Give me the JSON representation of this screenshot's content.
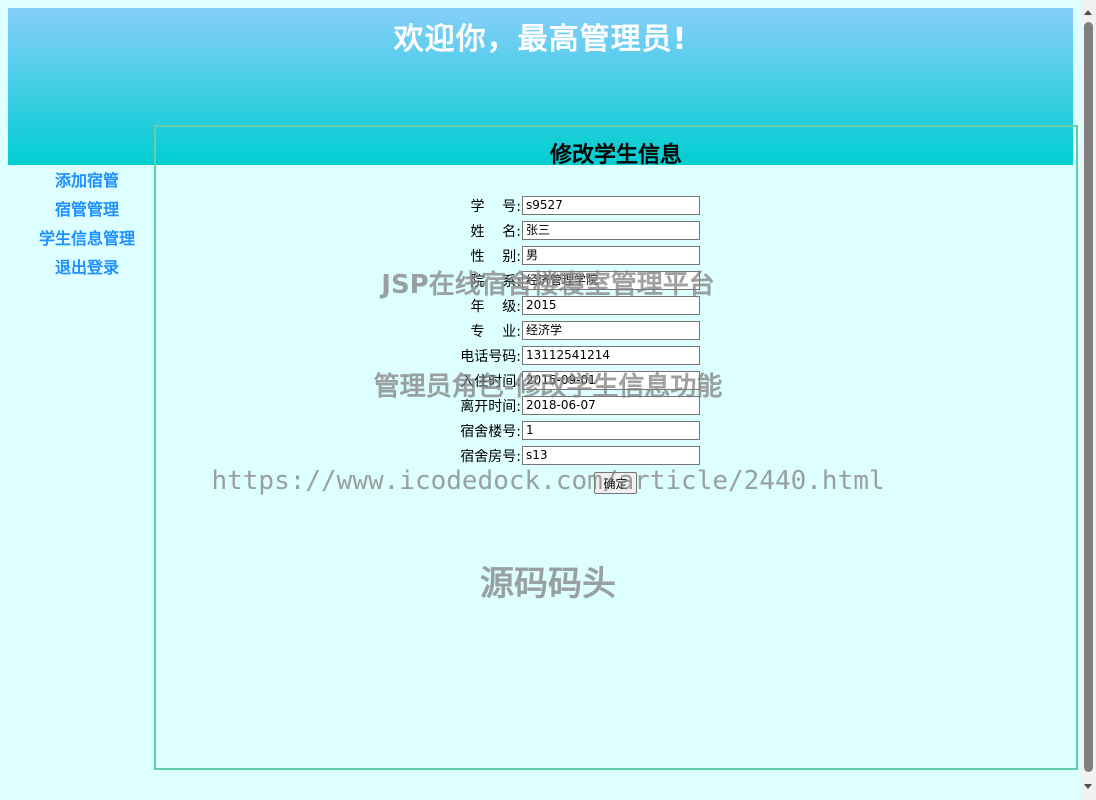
{
  "header": {
    "title": "欢迎你，最高管理员!"
  },
  "sidebar": {
    "items": [
      {
        "label": "添加宿管"
      },
      {
        "label": "宿管管理"
      },
      {
        "label": "学生信息管理"
      },
      {
        "label": "退出登录"
      }
    ]
  },
  "form": {
    "title": "修改学生信息",
    "fields": [
      {
        "label": "学    号:",
        "value": "s9527"
      },
      {
        "label": "姓    名:",
        "value": "张三"
      },
      {
        "label": "性    别:",
        "value": "男"
      },
      {
        "label": "院    系:",
        "value": "经济管理学院"
      },
      {
        "label": "年    级:",
        "value": "2015"
      },
      {
        "label": "专    业:",
        "value": "经济学"
      },
      {
        "label": "电话号码:",
        "value": "13112541214"
      },
      {
        "label": "入住时间:",
        "value": "2015-09-01"
      },
      {
        "label": "离开时间:",
        "value": "2018-06-07"
      },
      {
        "label": "宿舍楼号:",
        "value": "1"
      },
      {
        "label": "宿舍房号:",
        "value": "s13"
      }
    ],
    "submit_label": "确定"
  },
  "watermarks": [
    "JSP在线宿舍楼寝室管理平台",
    "管理员角色-修改学生信息功能",
    "https://www.icodedock.com/article/2440.html",
    "源码码头"
  ],
  "colors": {
    "banner_top": "#87cefa",
    "banner_bottom": "#00ced1",
    "page_background": "#ddffff",
    "sidebar_link": "#1e90ff",
    "panel_border": "#66cdaa"
  }
}
